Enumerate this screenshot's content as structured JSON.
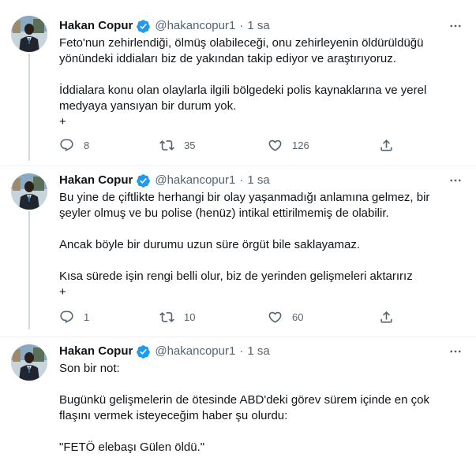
{
  "colors": {
    "verified": "#1d9bf0",
    "secondary_text": "#536471",
    "text": "#0f1419",
    "divider": "#eff3f4"
  },
  "tweets": [
    {
      "name": "Hakan Copur",
      "handle": "@hakancopur1",
      "separator": "·",
      "time": "1 sa",
      "lines": [
        "Feto'nun zehirlendiği, ölmüş olabileceği, onu zehirleyenin öldürüldüğü",
        "yönündeki iddiaları biz de yakından takip ediyor ve araştırıyoruz.",
        "",
        "İddialara konu olan olaylarla ilgili bölgedeki polis kaynaklarına ve yerel",
        "medyaya yansıyan bir durum yok.",
        "+"
      ],
      "replies": "8",
      "retweets": "35",
      "likes": "126"
    },
    {
      "name": "Hakan Copur",
      "handle": "@hakancopur1",
      "separator": "·",
      "time": "1 sa",
      "lines": [
        "Bu yine de çiftlikte herhangi bir olay yaşanmadığı anlamına gelmez, bir",
        "şeyler olmuş ve bu polise (henüz) intikal ettirilmemiş de olabilir.",
        "",
        "Ancak böyle bir durumu uzun süre örgüt bile saklayamaz.",
        "",
        "Kısa sürede işin rengi belli olur, biz de yerinden gelişmeleri aktarırız",
        "+"
      ],
      "replies": "1",
      "retweets": "10",
      "likes": "60"
    },
    {
      "name": "Hakan Copur",
      "handle": "@hakancopur1",
      "separator": "·",
      "time": "1 sa",
      "lines": [
        "Son bir not:",
        "",
        "Bugünkü gelişmelerin de ötesinde ABD'deki görev sürem içinde en çok",
        "flaşını vermek isteyeceğim haber şu olurdu:",
        "",
        "\"FETÖ elebaşı Gülen öldü.\""
      ]
    }
  ]
}
